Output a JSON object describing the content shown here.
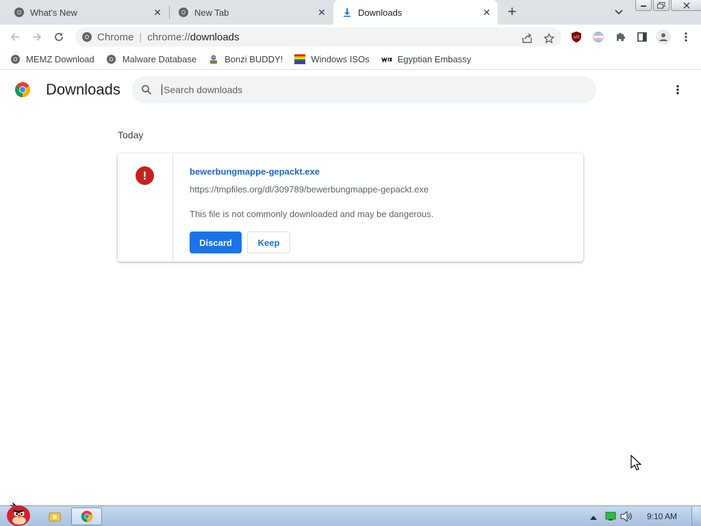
{
  "browser": {
    "tabs": [
      {
        "title": "What's New",
        "active": false
      },
      {
        "title": "New Tab",
        "active": false
      },
      {
        "title": "Downloads",
        "active": true
      }
    ],
    "omnibox": {
      "site_chip": "Chrome",
      "url_scheme": "chrome://",
      "url_host": "downloads"
    },
    "bookmarks": [
      {
        "label": "MEMZ Download",
        "icon": "globe-icon"
      },
      {
        "label": "Malware Database",
        "icon": "globe-icon"
      },
      {
        "label": "Bonzi BUDDY!",
        "icon": "bonzi-icon"
      },
      {
        "label": "Windows ISOs",
        "icon": "rainbow-flag-icon"
      },
      {
        "label": "Egyptian Embassy",
        "icon": "wix-icon"
      }
    ]
  },
  "page": {
    "title": "Downloads",
    "search": {
      "placeholder": "Search downloads",
      "value": ""
    },
    "date_heading": "Today",
    "download": {
      "file_name": "bewerbungmappe-gepackt.exe",
      "url": "https://tmpfiles.org/dl/309789/bewerbungmappe-gepackt.exe",
      "warning": "This file is not commonly downloaded and may be dangerous.",
      "discard_label": "Discard",
      "keep_label": "Keep",
      "warn_glyph": "!"
    }
  },
  "taskbar": {
    "clock": "9:10 AM"
  },
  "colors": {
    "accent": "#1a73e8",
    "danger": "#c5221f",
    "link": "#1967d2"
  }
}
